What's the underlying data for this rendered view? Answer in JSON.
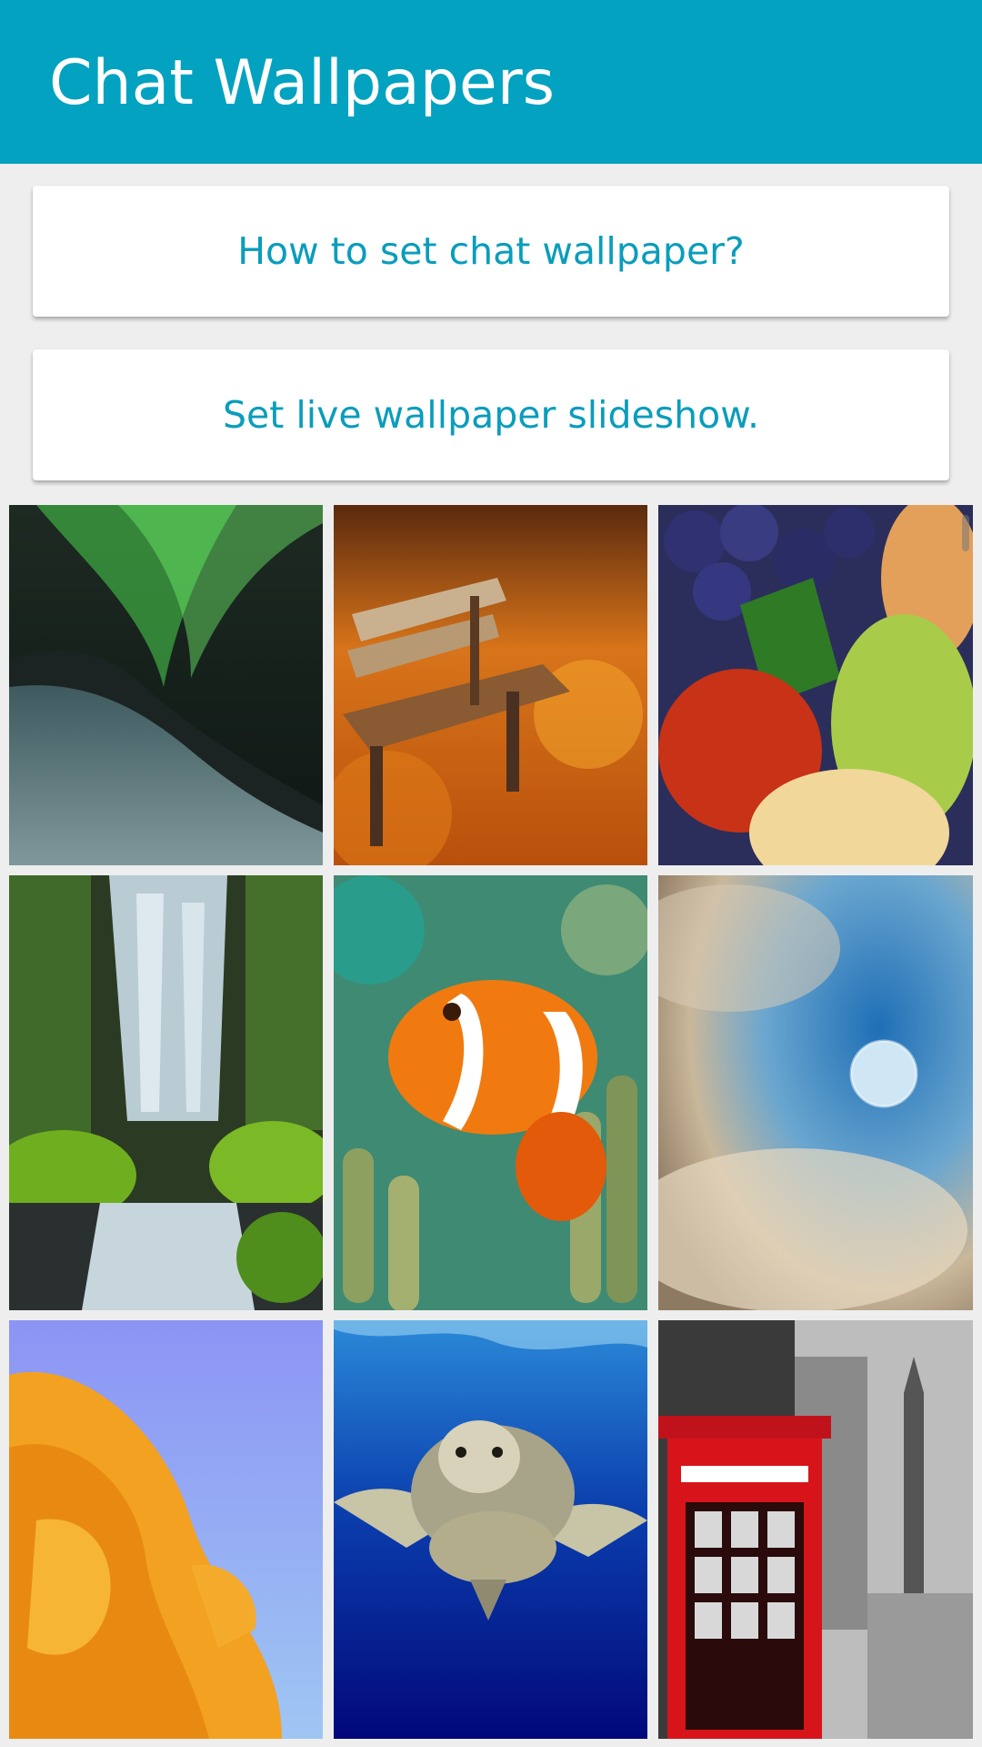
{
  "header": {
    "title": "Chat Wallpapers"
  },
  "actions": {
    "help_label": "How to set chat wallpaper?",
    "slideshow_label": "Set live wallpaper slideshow."
  },
  "colors": {
    "accent": "#02a2c0",
    "link_text": "#0a9dbc",
    "background": "#eeeeee"
  },
  "wallpapers": [
    {
      "subject": "aurora-over-snowy-hill"
    },
    {
      "subject": "park-bench-autumn-leaves"
    },
    {
      "subject": "fruit-grapes-pineapple-apple"
    },
    {
      "subject": "mossy-waterfall"
    },
    {
      "subject": "clownfish-in-anemone"
    },
    {
      "subject": "moon-in-cloudy-sky"
    },
    {
      "subject": "orange-rose-blue-sky"
    },
    {
      "subject": "sea-turtle-underwater"
    },
    {
      "subject": "red-telephone-box-london"
    }
  ]
}
